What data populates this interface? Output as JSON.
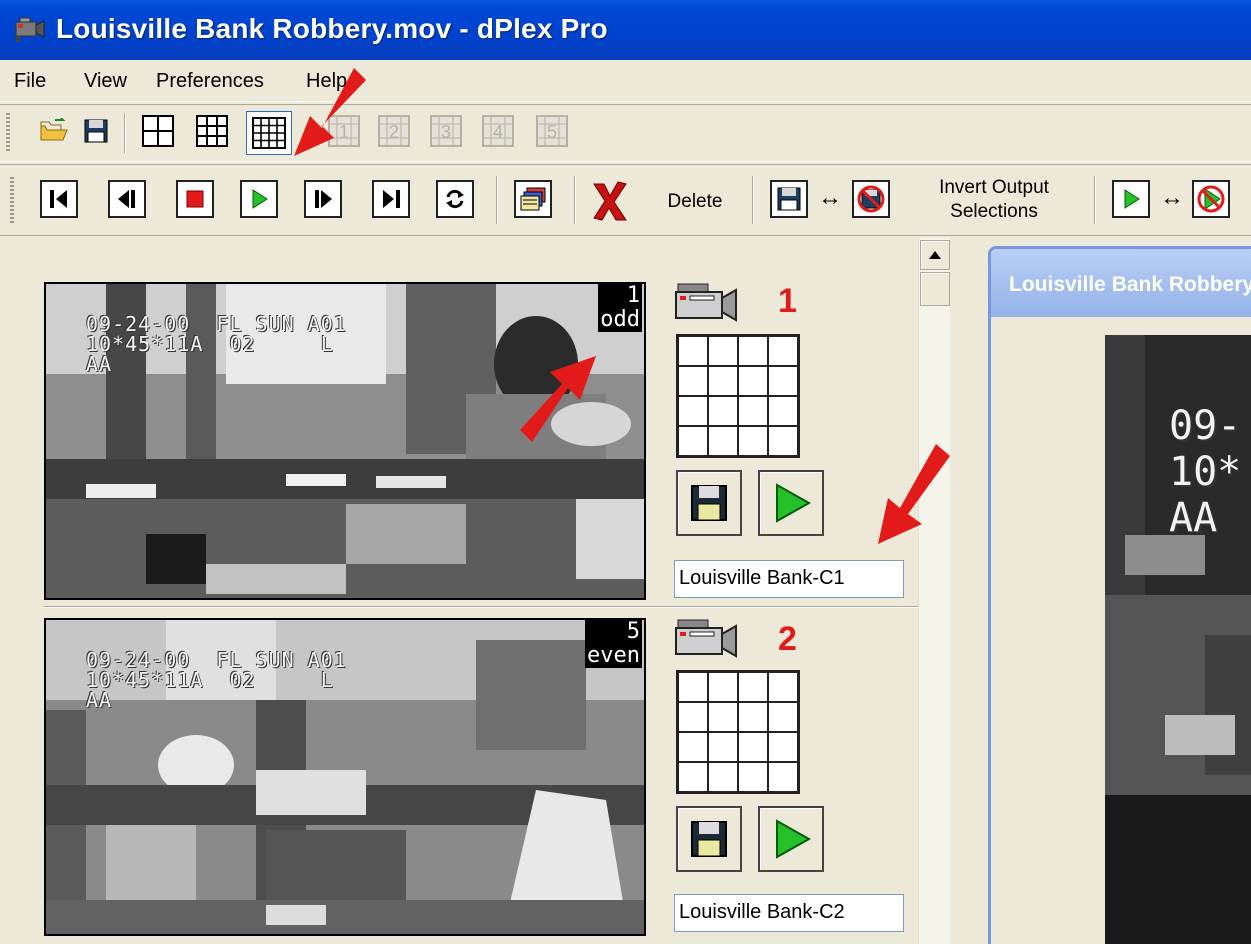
{
  "window": {
    "title": "Louisville Bank Robbery.mov - dPlex Pro",
    "app_icon": "video-camera-app-icon"
  },
  "menu": {
    "items": [
      "File",
      "View",
      "Preferences",
      "Help"
    ]
  },
  "toolbar_top": {
    "buttons": [
      {
        "name": "open-folder-icon"
      },
      {
        "name": "save-disk-icon"
      },
      {
        "name": "layout-2x2-icon"
      },
      {
        "name": "layout-3x3-icon"
      },
      {
        "name": "layout-4x4-icon",
        "pressed": true
      },
      {
        "name": "page-1-icon",
        "label": "1"
      },
      {
        "name": "page-2-icon",
        "label": "2"
      },
      {
        "name": "page-3-icon",
        "label": "3"
      },
      {
        "name": "page-4-icon",
        "label": "4"
      },
      {
        "name": "page-5-icon",
        "label": "5"
      }
    ]
  },
  "toolbar_bottom": {
    "buttons": [
      {
        "name": "skip-to-start-icon"
      },
      {
        "name": "step-back-icon"
      },
      {
        "name": "stop-icon"
      },
      {
        "name": "play-icon"
      },
      {
        "name": "step-forward-icon"
      },
      {
        "name": "skip-to-end-icon"
      },
      {
        "name": "loop-icon"
      },
      {
        "name": "export-frames-icon"
      }
    ],
    "delete_label": "Delete",
    "invert_output_label_line1": "Invert Output",
    "invert_output_label_line2": "Selections"
  },
  "cameras": [
    {
      "number": "1",
      "field": "odd",
      "frame_index": "1",
      "osd_line1": "09-24-00  FL SUN A01",
      "osd_line2": "10*45*11A  02     L",
      "osd_line3": "AA",
      "name": "Louisville Bank-C1"
    },
    {
      "number": "2",
      "field": "even",
      "frame_index": "5",
      "osd_line1": "09-24-00  FL SUN A01",
      "osd_line2": "10*45*11A  02     L",
      "osd_line3": "AA",
      "name": "Louisville Bank-C2"
    }
  ],
  "preview_window": {
    "title": "Louisville Bank Robbery.mov",
    "osd_line1": "09-",
    "osd_line2": "10*",
    "osd_line3": "AA"
  },
  "annotation_color": "#e31a1a"
}
